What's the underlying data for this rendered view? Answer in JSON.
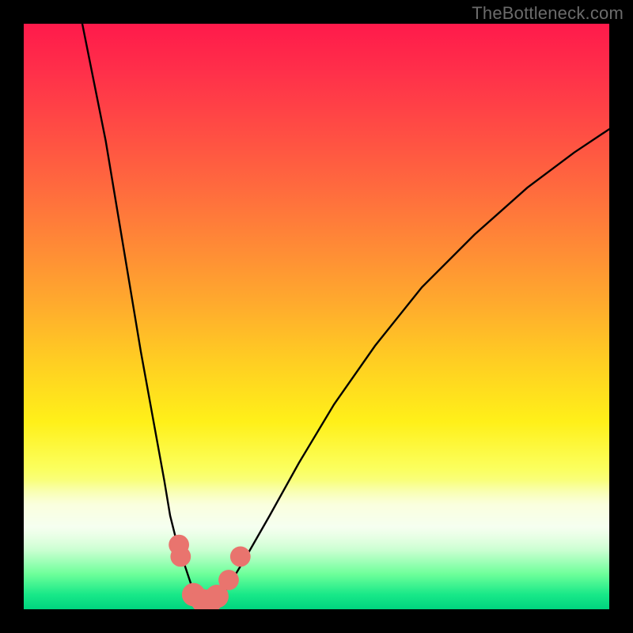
{
  "watermark": "TheBottleneck.com",
  "chart_data": {
    "type": "line",
    "title": "",
    "xlabel": "",
    "ylabel": "",
    "xlim": [
      0,
      100
    ],
    "ylim": [
      0,
      100
    ],
    "grid": false,
    "legend": false,
    "background": "rainbow-gradient red→yellow→green (top→bottom)",
    "series": [
      {
        "name": "left-branch",
        "x": [
          10,
          12,
          14,
          16,
          18,
          20,
          22,
          24,
          25,
          26,
          27,
          28,
          29,
          30
        ],
        "y": [
          100,
          90,
          80,
          68,
          56,
          44,
          33,
          22,
          16,
          12,
          9,
          6,
          3,
          1
        ]
      },
      {
        "name": "right-branch",
        "x": [
          33,
          35,
          38,
          42,
          47,
          53,
          60,
          68,
          77,
          86,
          94,
          100
        ],
        "y": [
          1,
          4,
          9,
          16,
          25,
          35,
          45,
          55,
          64,
          72,
          78,
          82
        ]
      },
      {
        "name": "floor",
        "x": [
          29,
          30,
          31,
          32,
          33
        ],
        "y": [
          1,
          0.5,
          0.3,
          0.5,
          1
        ]
      }
    ],
    "markers": [
      {
        "name": "left-dot-upper",
        "x": 26.5,
        "y": 11,
        "r": 1.0
      },
      {
        "name": "left-dot-lower",
        "x": 26.8,
        "y": 9,
        "r": 1.0
      },
      {
        "name": "floor-dot-1",
        "x": 29.0,
        "y": 2.5,
        "r": 1.2
      },
      {
        "name": "floor-dot-2",
        "x": 30.5,
        "y": 1.5,
        "r": 1.2
      },
      {
        "name": "floor-dot-3",
        "x": 32.0,
        "y": 1.5,
        "r": 1.2
      },
      {
        "name": "floor-dot-4",
        "x": 33.0,
        "y": 2.2,
        "r": 1.2
      },
      {
        "name": "right-dot-lower",
        "x": 35.0,
        "y": 5.0,
        "r": 1.0
      },
      {
        "name": "right-dot-upper",
        "x": 37.0,
        "y": 9.0,
        "r": 1.0
      }
    ],
    "note": "Values are estimated from pixel positions; chart has no numeric axes or labels. y=0 is bottom (green), y=100 is top (red)."
  }
}
